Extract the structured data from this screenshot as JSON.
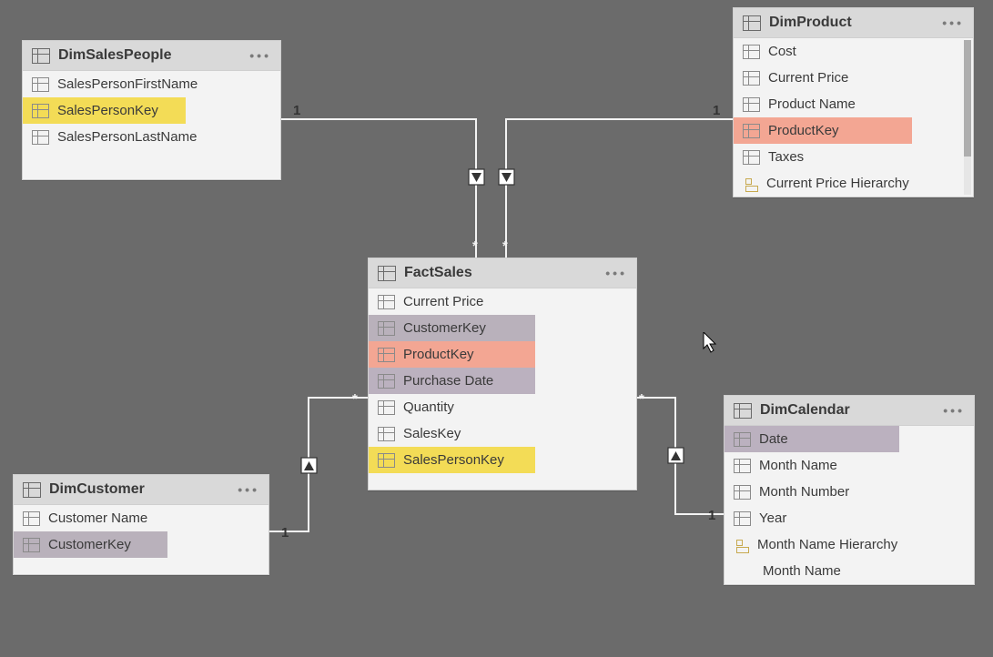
{
  "tables": {
    "dimSalesPeople": {
      "title": "DimSalesPeople",
      "fields": {
        "f0": "SalesPersonFirstName",
        "f1": "SalesPersonKey",
        "f2": "SalesPersonLastName"
      }
    },
    "dimProduct": {
      "title": "DimProduct",
      "fields": {
        "f0": "Cost",
        "f1": "Current Price",
        "f2": "Product Name",
        "f3": "ProductKey",
        "f4": "Taxes",
        "f5": "Current Price Hierarchy"
      }
    },
    "factSales": {
      "title": "FactSales",
      "fields": {
        "f0": "Current Price",
        "f1": "CustomerKey",
        "f2": "ProductKey",
        "f3": "Purchase Date",
        "f4": "Quantity",
        "f5": "SalesKey",
        "f6": "SalesPersonKey"
      }
    },
    "dimCustomer": {
      "title": "DimCustomer",
      "fields": {
        "f0": "Customer Name",
        "f1": "CustomerKey"
      }
    },
    "dimCalendar": {
      "title": "DimCalendar",
      "fields": {
        "f0": "Date",
        "f1": "Month Name",
        "f2": "Month Number",
        "f3": "Year",
        "f4": "Month Name Hierarchy",
        "f5": "Month Name"
      }
    }
  },
  "relationships": {
    "salesPeopleToFact": {
      "from": "1",
      "to": "*",
      "direction": "down"
    },
    "productToFact": {
      "from": "1",
      "to": "*",
      "direction": "down"
    },
    "customerToFact": {
      "from": "1",
      "to": "*",
      "direction": "up"
    },
    "calendarToFact": {
      "from": "1",
      "to": "*",
      "direction": "up"
    }
  },
  "highlights": {
    "salesPersonKey": "yellow",
    "productKey": "salmon",
    "customerKey": "grey",
    "purchaseDate": "mauve",
    "date": "mauve"
  }
}
